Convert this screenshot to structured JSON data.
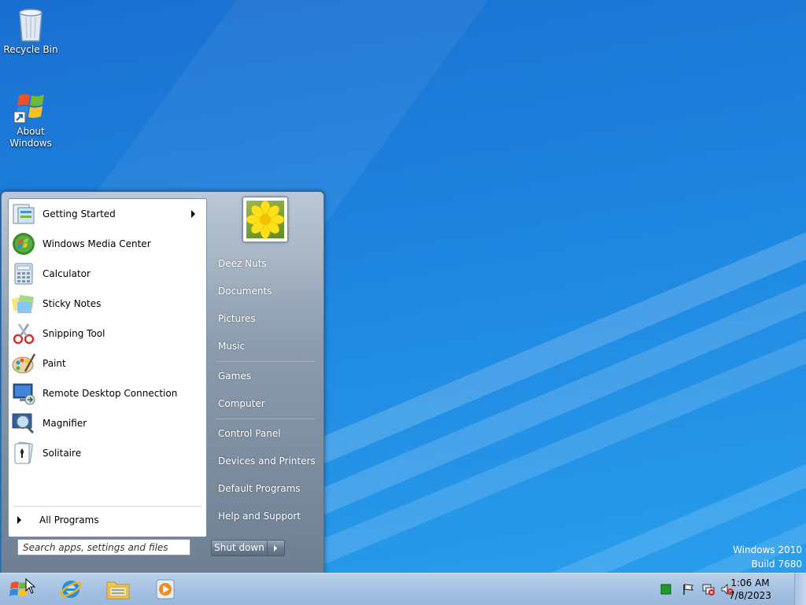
{
  "desktop": {
    "icons": [
      {
        "label": "Recycle Bin",
        "icon": "recycle-bin-icon"
      },
      {
        "label": "About Windows",
        "icon": "windows-flag-icon"
      }
    ],
    "watermark": {
      "line1": "Windows 2010",
      "line2": "Build 7680"
    }
  },
  "start_menu": {
    "programs": [
      {
        "label": "Getting Started",
        "icon": "getting-started-icon",
        "has_submenu": true
      },
      {
        "label": "Windows Media Center",
        "icon": "media-center-icon"
      },
      {
        "label": "Calculator",
        "icon": "calculator-icon"
      },
      {
        "label": "Sticky Notes",
        "icon": "sticky-notes-icon"
      },
      {
        "label": "Snipping Tool",
        "icon": "scissors-icon"
      },
      {
        "label": "Paint",
        "icon": "paint-palette-icon"
      },
      {
        "label": "Remote Desktop Connection",
        "icon": "remote-desktop-icon"
      },
      {
        "label": "Magnifier",
        "icon": "magnifier-icon"
      },
      {
        "label": "Solitaire",
        "icon": "solitaire-card-icon"
      }
    ],
    "all_programs": "All Programs",
    "search_placeholder": "Search apps, settings and files",
    "right_items": [
      "Deez Nuts",
      "Documents",
      "Pictures",
      "Music",
      "Games",
      "Computer",
      "Control Panel",
      "Devices and Printers",
      "Default Programs",
      "Help and Support"
    ],
    "shutdown_label": "Shut down",
    "avatar_icon": "flower-avatar-icon"
  },
  "taskbar": {
    "pinned": [
      {
        "name": "start-orb",
        "icon": "windows-orb-icon"
      },
      {
        "name": "internet-explorer",
        "icon": "internet-explorer-icon"
      },
      {
        "name": "windows-explorer",
        "icon": "folder-icon"
      },
      {
        "name": "media-player",
        "icon": "media-player-icon"
      }
    ],
    "tray": [
      "green-square-icon",
      "action-center-flag-icon",
      "network-error-icon",
      "volume-muted-icon"
    ],
    "clock": {
      "time": "1:06 AM",
      "date": "7/8/2023"
    }
  },
  "colors": {
    "desktop": "#1e86e0",
    "taskbar": "#a6c2e2",
    "menu_right": "#7c8ca0"
  }
}
